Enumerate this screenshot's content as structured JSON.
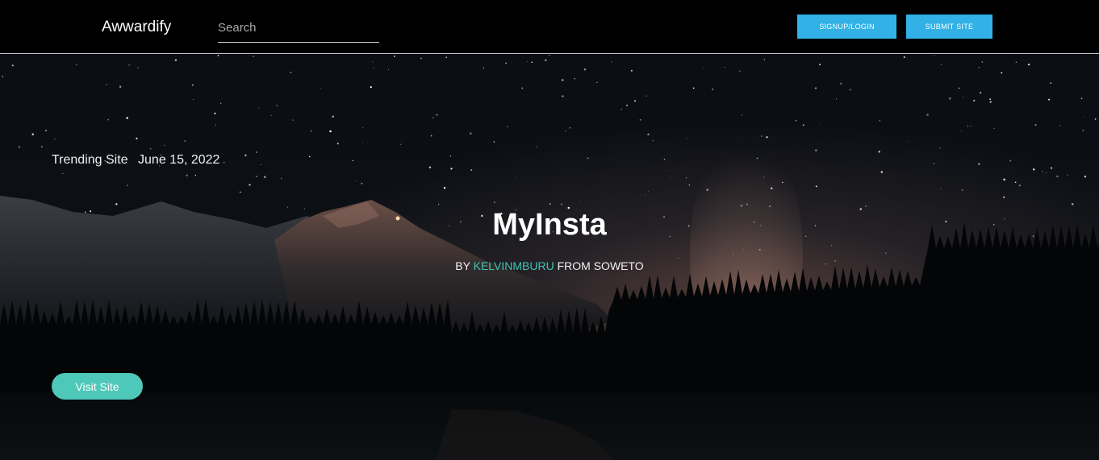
{
  "navbar": {
    "brand": "Awwardify",
    "search_placeholder": "Search",
    "signup_label": "SIGNUP/LOGIN",
    "submit_label": "SUBMIT SITE"
  },
  "hero": {
    "badge": "Trending Site",
    "date": "June 15, 2022",
    "title": "MyInsta",
    "by_prefix": "BY",
    "author": "KELVINMBURU",
    "from_text": "FROM SOWETO",
    "visit_label": "Visit Site",
    "background_image": "night-sky-mountain-forest-lake"
  },
  "colors": {
    "navbar_bg": "#000000",
    "nav_button": "#31b1e5",
    "accent_teal": "#4ec8b8",
    "author_link": "#3fc4b4"
  }
}
